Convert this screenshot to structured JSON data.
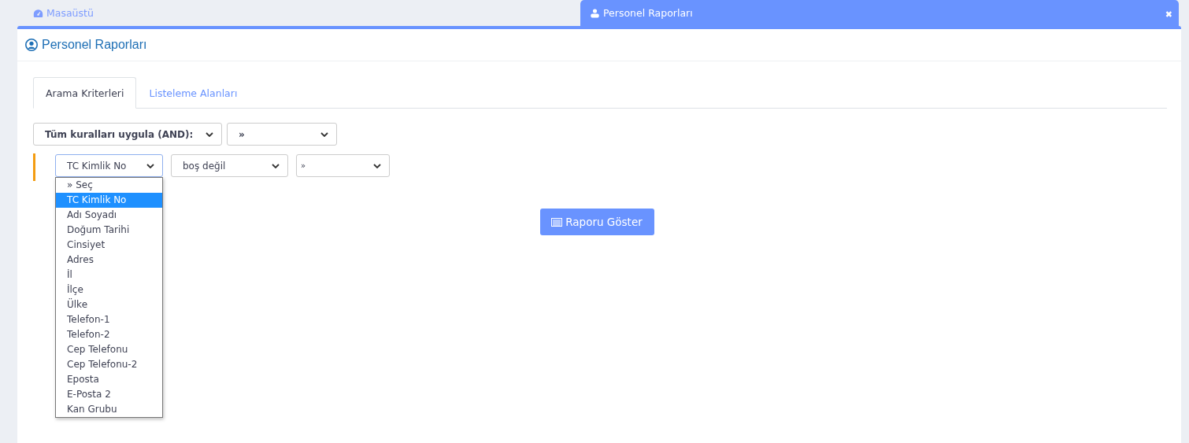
{
  "top_tabs": [
    {
      "label": "Masaüstü",
      "selected": false
    },
    {
      "label": "Personel Raporları",
      "selected": true,
      "close": "✖"
    }
  ],
  "panel": {
    "title": "Personel Raporları"
  },
  "tabs": [
    {
      "label": "Arama Kriterleri",
      "selected": true
    },
    {
      "label": "Listeleme Alanları",
      "selected": false
    }
  ],
  "group": {
    "condition": "Tüm kuralları uygula (AND):",
    "action": "»"
  },
  "rule": {
    "field": "TC Kimlik No",
    "operator": "boş değil",
    "value": "»"
  },
  "field_options": [
    {
      "label": "» Seç",
      "selected": false
    },
    {
      "label": "TC Kimlik No",
      "selected": true
    },
    {
      "label": "Adı Soyadı",
      "selected": false
    },
    {
      "label": "Doğum Tarihi",
      "selected": false
    },
    {
      "label": "Cinsiyet",
      "selected": false
    },
    {
      "label": "Adres",
      "selected": false
    },
    {
      "label": "İl",
      "selected": false
    },
    {
      "label": "İlçe",
      "selected": false
    },
    {
      "label": "Ülke",
      "selected": false
    },
    {
      "label": "Telefon-1",
      "selected": false
    },
    {
      "label": "Telefon-2",
      "selected": false
    },
    {
      "label": "Cep Telefonu",
      "selected": false
    },
    {
      "label": "Cep Telefonu-2",
      "selected": false
    },
    {
      "label": "Eposta",
      "selected": false
    },
    {
      "label": "E-Posta 2",
      "selected": false
    },
    {
      "label": "Kan Grubu",
      "selected": false
    }
  ],
  "report_button": "Raporu Göster"
}
